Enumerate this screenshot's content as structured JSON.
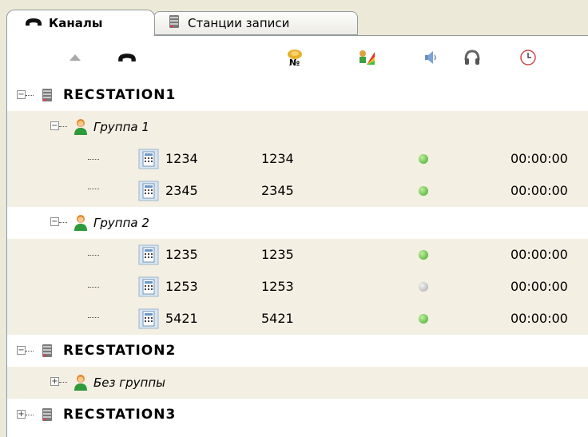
{
  "tabs": [
    {
      "label": "Каналы",
      "icon": "phone-handset-icon",
      "active": true
    },
    {
      "label": "Станции записи",
      "icon": "recording-station-icon",
      "active": false
    }
  ],
  "columns": [
    {
      "icon": "sort-ascending-icon"
    },
    {
      "icon": "phone-handset-icon"
    },
    {
      "icon": "number-badge-icon"
    },
    {
      "icon": "user-level-icon"
    },
    {
      "icon": "speaker-icon"
    },
    {
      "icon": "headphones-icon"
    },
    {
      "icon": "clock-icon"
    }
  ],
  "tree": {
    "stations": [
      {
        "name": "RECSTATION1",
        "expanded": true,
        "groups": [
          {
            "name": "Группа 1",
            "expanded": true,
            "channels": [
              {
                "name": "1234",
                "number": "1234",
                "status": "active",
                "time": "00:00:00"
              },
              {
                "name": "2345",
                "number": "2345",
                "status": "active",
                "time": "00:00:00"
              }
            ]
          },
          {
            "name": "Группа 2",
            "expanded": true,
            "channels": [
              {
                "name": "1235",
                "number": "1235",
                "status": "active",
                "time": "00:00:00"
              },
              {
                "name": "1253",
                "number": "1253",
                "status": "inactive",
                "time": "00:00:00"
              },
              {
                "name": "5421",
                "number": "5421",
                "status": "active",
                "time": "00:00:00"
              }
            ]
          }
        ]
      },
      {
        "name": "RECSTATION2",
        "expanded": true,
        "groups": [
          {
            "name": "Без группы",
            "expanded": false,
            "channels": []
          }
        ]
      },
      {
        "name": "RECSTATION3",
        "expanded": false,
        "groups": []
      }
    ]
  },
  "colors": {
    "row_alt": "#f4efe3",
    "led_active": "#5fc23a",
    "led_inactive": "#c8c8c8"
  }
}
